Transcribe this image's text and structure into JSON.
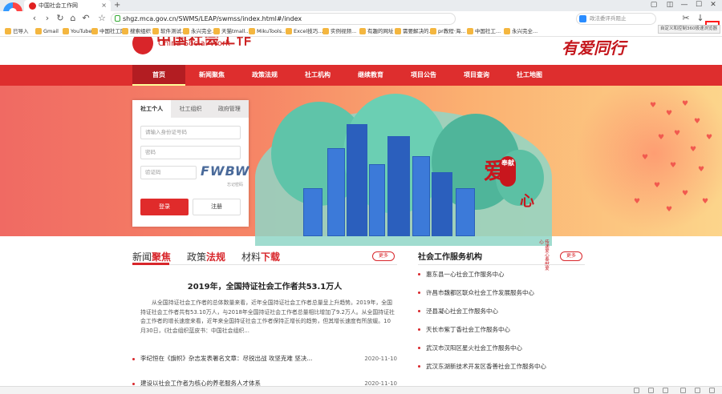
{
  "browser": {
    "tab_title": "中国社会工作网",
    "tab_close": "×",
    "new_tab": "+",
    "url": "shgz.mca.gov.cn/SWMS/LEAP/swmss/index.html#/index",
    "search_placeholder": "政法委评兵阻止",
    "menu_tooltip": "自定义和控制360极速浏览器",
    "menu_glyph": "≡",
    "nav": {
      "back": "‹",
      "forward": "›",
      "reload": "↻",
      "home": "⌂",
      "undo": "↶",
      "restore": "↷",
      "star": "☆",
      "scissors": "✂",
      "download": "↓"
    },
    "window": {
      "min": "—",
      "max": "☐",
      "close": "✕"
    }
  },
  "bookmarks": [
    "已导入",
    "Gmail",
    "YouTube",
    "中国社工网",
    "搜索组织",
    "软件测试...",
    "永兴完全...",
    "天猫tmall...",
    "MikuTools...",
    "Excel技巧...",
    "实例视频...",
    "有趣的网址",
    "需要解决的...",
    "pr教程·海...",
    "中国社工...",
    "永兴完全..."
  ],
  "site": {
    "logo_cn": "中国社会工作",
    "logo_en": "China Social Work",
    "slogan": "有爱同行",
    "nav": [
      "首页",
      "新闻聚焦",
      "政策法规",
      "社工机构",
      "继续教育",
      "项目公告",
      "项目查询",
      "社工地图"
    ],
    "banner": {
      "big": "爱",
      "small": "心",
      "stamp": "奉献",
      "vertical": "传递爱心奉献爱心"
    }
  },
  "login": {
    "tabs": [
      "社工个人",
      "社工组织",
      "政府管理"
    ],
    "id_placeholder": "请输入身份证号码",
    "password_placeholder": "密码",
    "captcha_placeholder": "验证码",
    "captcha_text": "FWBW",
    "forgot": "忘记密码",
    "login_btn": "登录",
    "register_btn": "注册"
  },
  "news": {
    "tabs": [
      {
        "plain": "新闻",
        "hl": "聚焦"
      },
      {
        "plain": "政策",
        "hl": "法规"
      },
      {
        "plain": "材料",
        "hl": "下载"
      }
    ],
    "more": "更多",
    "headline": "2019年，全国持证社会工作者共53.1万人",
    "summary": "从全国持证社会工作者的总体数量来看，近年全国持证社会工作者总量呈上升趋势。2019年，全国持证社会工作者共有53.10万人，与2018年全国持证社会工作者总量相比增加了9.2万人。从全国持证社会工作者的增长速度来看，近年来全国持证社会工作者保持正增长的趋势，但其增长速度有所放缓。10月30日，《社会组织蓝皮书：中国社会组织...",
    "items": [
      {
        "title": "李纪恒在《旗帜》杂志发表署名文章：尽锐出战 攻坚克难 坚决...",
        "date": "2020-11-10"
      },
      {
        "title": "建设以社会工作者为核心的养老服务人才体系",
        "date": "2020-11-10"
      }
    ]
  },
  "orgs": {
    "title": "社会工作服务机构",
    "more": "更多",
    "items": [
      "惠东县一心社会工作服务中心",
      "许昌市魏都区联众社会工作发展服务中心",
      "泾县凝心社会工作服务中心",
      "天长市紫丁香社会工作服务中心",
      "武汉市汉阳区星火社会工作服务中心",
      "武汉东湖新技术开发区香善社会工作服务中心"
    ]
  }
}
